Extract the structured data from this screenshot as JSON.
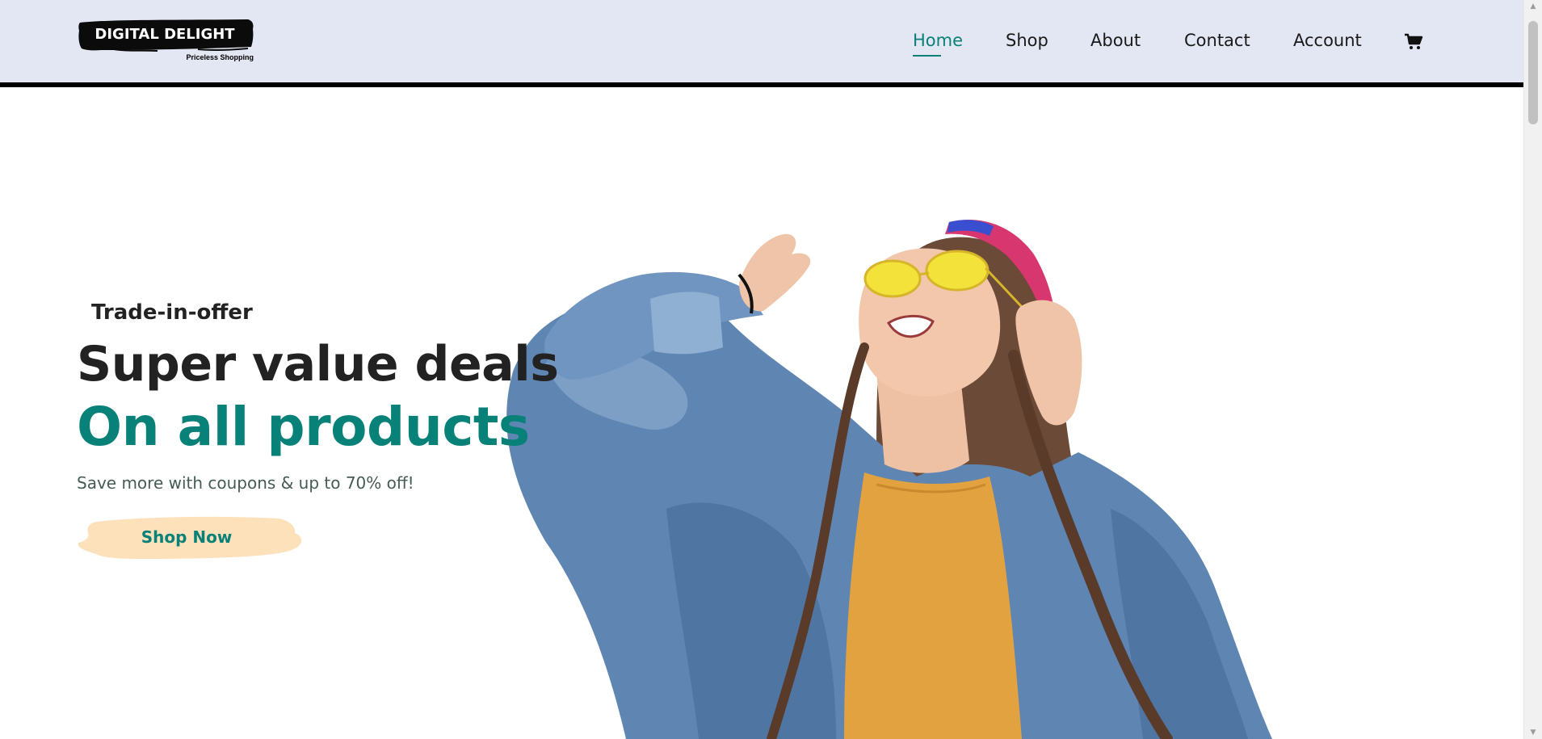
{
  "header": {
    "logo": {
      "title": "DIGITAL DELIGHT",
      "tagline": "Priceless Shopping"
    },
    "nav": {
      "items": [
        {
          "label": "Home",
          "active": true
        },
        {
          "label": "Shop",
          "active": false
        },
        {
          "label": "About",
          "active": false
        },
        {
          "label": "Contact",
          "active": false
        },
        {
          "label": "Account",
          "active": false
        }
      ],
      "cart_icon": "shopping-cart-icon"
    }
  },
  "hero": {
    "eyebrow": "Trade-in-offer",
    "headline": "Super value deals",
    "subheadline": "On all products",
    "copy": "Save more with coupons & up to 70% off!",
    "cta_label": "Shop Now",
    "photo": "woman-with-headphones-photo"
  },
  "colors": {
    "header_bg": "#e3e6f3",
    "accent": "#088178",
    "cta_bg": "#fde1bb",
    "text_dark": "#222222",
    "text_muted": "#465b52"
  }
}
